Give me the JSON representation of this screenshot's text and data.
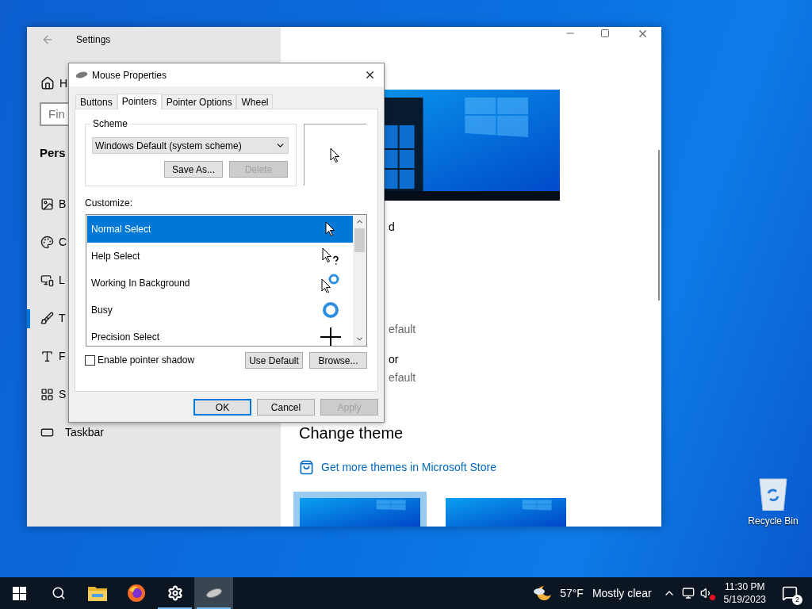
{
  "desktop": {
    "icons": [
      {
        "label": "Recycle Bin"
      }
    ]
  },
  "settings_window": {
    "title": "Settings",
    "sidebar": {
      "home_label": "H",
      "search_placeholder": "Fin",
      "section": "Pers",
      "items": [
        {
          "kind": "background",
          "label": "B",
          "selected": false
        },
        {
          "kind": "colors",
          "label": "C",
          "selected": false
        },
        {
          "kind": "lock-screen",
          "label": "L",
          "selected": false
        },
        {
          "kind": "themes",
          "label": "T",
          "selected": true
        },
        {
          "kind": "fonts",
          "label": "F",
          "selected": false
        },
        {
          "kind": "start",
          "label": "S",
          "selected": false
        },
        {
          "kind": "taskbar",
          "label": "Taskbar",
          "selected": false
        }
      ]
    },
    "content": {
      "fragments": [
        "d",
        "efault",
        "or",
        "efault"
      ],
      "heading": "Change theme",
      "store_link": "Get more themes in Microsoft Store",
      "themes": [
        {
          "selected": true
        },
        {
          "selected": false
        }
      ]
    }
  },
  "dialog": {
    "title": "Mouse Properties",
    "tabs": [
      {
        "label": "Buttons",
        "selected": false
      },
      {
        "label": "Pointers",
        "selected": true
      },
      {
        "label": "Pointer Options",
        "selected": false
      },
      {
        "label": "Wheel",
        "selected": false
      }
    ],
    "scheme": {
      "label": "Scheme",
      "value": "Windows Default (system scheme)",
      "buttons": [
        {
          "label": "Save As...",
          "disabled": false
        },
        {
          "label": "Delete",
          "disabled": true
        }
      ]
    },
    "customize": {
      "label": "Customize:",
      "rows": [
        {
          "kind": "arrow",
          "label": "Normal Select",
          "selected": true
        },
        {
          "kind": "help",
          "label": "Help Select",
          "selected": false
        },
        {
          "kind": "working",
          "label": "Working In Background",
          "selected": false
        },
        {
          "kind": "busy",
          "label": "Busy",
          "selected": false
        },
        {
          "kind": "precision",
          "label": "Precision Select",
          "selected": false
        }
      ]
    },
    "pointer_shadow": {
      "label": "Enable pointer shadow",
      "checked": false
    },
    "list_buttons": [
      {
        "label": "Use Default",
        "disabled": false
      },
      {
        "label": "Browse...",
        "disabled": false
      }
    ],
    "footer_buttons": [
      {
        "label": "OK",
        "default": true,
        "disabled": false
      },
      {
        "label": "Cancel",
        "default": false,
        "disabled": false
      },
      {
        "label": "Apply",
        "default": false,
        "disabled": true
      }
    ]
  },
  "taskbar": {
    "apps": [
      {
        "kind": "start",
        "open": false,
        "selected": false
      },
      {
        "kind": "search",
        "open": false,
        "selected": false
      },
      {
        "kind": "explorer",
        "open": false,
        "selected": false
      },
      {
        "kind": "browser",
        "open": false,
        "selected": false
      },
      {
        "kind": "settings",
        "open": true,
        "selected": false
      },
      {
        "kind": "mouse",
        "open": true,
        "selected": true
      }
    ],
    "weather": {
      "temperature": "57°F",
      "condition": "Mostly clear"
    },
    "clock": {
      "time": "11:30 PM",
      "date": "5/19/2023"
    },
    "notifications": {
      "count": "2"
    }
  }
}
